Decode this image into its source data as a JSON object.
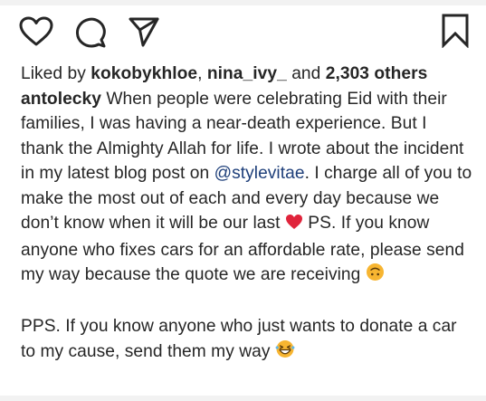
{
  "likes": {
    "prefix": "Liked by",
    "user1": "kokobykhloe",
    "separator": ",",
    "user2": "nina_ivy_",
    "and": "and",
    "others": "2,303 others"
  },
  "caption": {
    "username": "antolecky",
    "text1": "When people were celebrating Eid with their families, I was having a near-death experience. But I thank the Almighty Allah for life. I wrote about the incident in my latest blog post on",
    "mention": "@stylevitae",
    "text2": ". I charge all of you to make the most out of each and every day because we don’t know when it will be our last",
    "text3": "PS. If you know anyone who fixes cars for an affordable rate, please send my way because the quote we are receiving",
    "pps": "PPS. If you know anyone who just wants to donate a car to my cause, send them my way"
  },
  "icons": {
    "heart": "heart-outline-icon",
    "comment": "comment-bubble-icon",
    "share": "paper-plane-icon",
    "save": "bookmark-icon",
    "emoji1": "red-heart-emoji",
    "emoji2": "upside-down-face-emoji",
    "emoji3": "grinning-squinting-face-emoji"
  },
  "colors": {
    "text": "#262626",
    "mention": "#1e3f7a",
    "heart_emoji": "#e0243b",
    "emoji_face": "#f7b531"
  }
}
